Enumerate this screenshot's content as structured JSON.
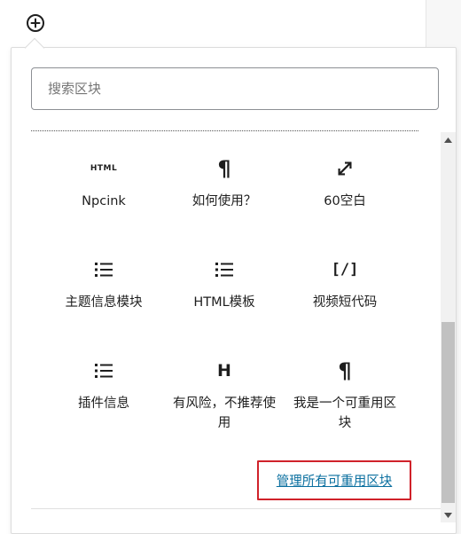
{
  "search": {
    "placeholder": "搜索区块",
    "value": ""
  },
  "blocks": [
    {
      "icon": "html-icon",
      "label": "Npcink"
    },
    {
      "icon": "paragraph-icon",
      "label": "如何使用？"
    },
    {
      "icon": "expand-icon",
      "label": "60空白"
    },
    {
      "icon": "list-icon",
      "label": "主题信息模块"
    },
    {
      "icon": "list-icon",
      "label": "HTML模板"
    },
    {
      "icon": "shortcode-icon",
      "label": "视频短代码"
    },
    {
      "icon": "list-icon",
      "label": "插件信息"
    },
    {
      "icon": "heading-icon",
      "label": "有风险，不推荐使用"
    },
    {
      "icon": "paragraph-icon",
      "label": "我是一个可重用区块"
    }
  ],
  "icons": {
    "html_text": "HTML",
    "heading_text": "H",
    "shortcode_text": "[/]",
    "paragraph_text": "¶"
  },
  "manage_link": {
    "label": "管理所有可重用区块"
  },
  "colors": {
    "accent_link": "#0a6f9f",
    "highlight_box": "#d0222a"
  }
}
